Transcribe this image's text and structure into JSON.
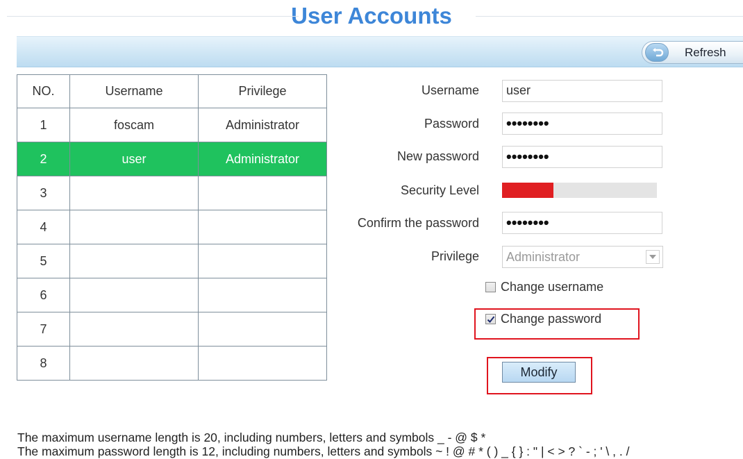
{
  "header": {
    "title": "User Accounts",
    "refresh_label": "Refresh"
  },
  "table": {
    "headers": [
      "NO.",
      "Username",
      "Privilege"
    ],
    "rows": [
      {
        "no": "1",
        "username": "foscam",
        "privilege": "Administrator"
      },
      {
        "no": "2",
        "username": "user",
        "privilege": "Administrator"
      },
      {
        "no": "3",
        "username": "",
        "privilege": ""
      },
      {
        "no": "4",
        "username": "",
        "privilege": ""
      },
      {
        "no": "5",
        "username": "",
        "privilege": ""
      },
      {
        "no": "6",
        "username": "",
        "privilege": ""
      },
      {
        "no": "7",
        "username": "",
        "privilege": ""
      },
      {
        "no": "8",
        "username": "",
        "privilege": ""
      }
    ],
    "selected_row": "2",
    "selected_color": "#1fc25e"
  },
  "form": {
    "username_label": "Username",
    "username_value": "user",
    "password_label": "Password",
    "password_value": "••••••••",
    "new_password_label": "New password",
    "new_password_value": "••••••••",
    "security_label": "Security Level",
    "security_level_fraction": 0.33,
    "security_color": "#e01f22",
    "confirm_label": "Confirm the password",
    "confirm_value": "••••••••",
    "privilege_label": "Privilege",
    "privilege_value": "Administrator",
    "change_username_label": "Change username",
    "change_username_checked": false,
    "change_password_label": "Change password",
    "change_password_checked": true,
    "modify_label": "Modify"
  },
  "notes": {
    "username_rule": "The maximum username length is 20, including numbers, letters and symbols _ - @ $ *",
    "password_rule": "The maximum password length is 12, including numbers, letters and symbols ~ ! @ # * ( ) _ { } : \" | < > ? ` - ; ' \\ , . /"
  },
  "colors": {
    "title": "#3d86d8",
    "highlight": "#e0141e"
  }
}
